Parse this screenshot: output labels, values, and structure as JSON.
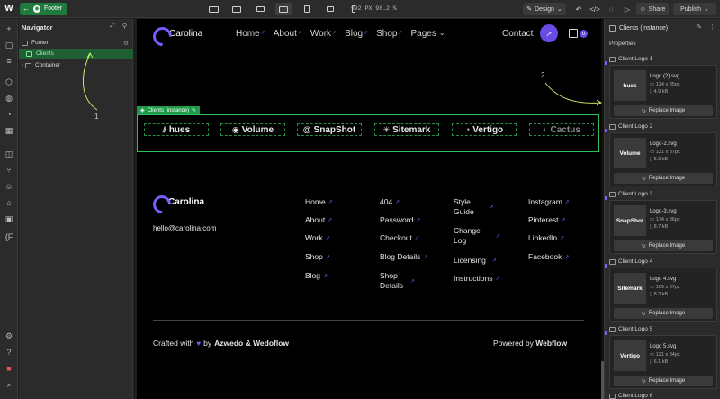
{
  "topbar": {
    "logo": "W",
    "page_name": "Footer",
    "dimensions": "992 PX 98.2 %",
    "mode_label": "Design",
    "share_label": "Share",
    "publish_label": "Publish"
  },
  "navigator": {
    "title": "Navigator",
    "items": [
      {
        "label": "Footer"
      },
      {
        "label": "Clients"
      },
      {
        "label": "Container"
      }
    ]
  },
  "site": {
    "brand": "Carolina",
    "nav": [
      "Home",
      "About",
      "Work",
      "Blog",
      "Shop",
      "Pages"
    ],
    "contact": "Contact",
    "cart_count": "0",
    "clients_label": "Clients (instance)",
    "clients": [
      "hues",
      "Volume",
      "SnapShot",
      "Sitemark",
      "Vertigo",
      "Cactus"
    ],
    "email": "hello@carolina.com",
    "footer_cols": [
      [
        "Home",
        "About",
        "Work",
        "Shop",
        "Blog"
      ],
      [
        "404",
        "Password",
        "Checkout",
        "Blog Details",
        "Shop|Details"
      ],
      [
        "Style|Guide",
        "Change|Log",
        "Licensing",
        "Instructions"
      ],
      [
        "Instagram",
        "Pinterest",
        "LinkedIn",
        "Facebook"
      ]
    ],
    "crafted_prefix": "Crafted with",
    "crafted_by": "by",
    "crafted_authors": "Azwedo & Wedoflow",
    "powered_prefix": "Powered by",
    "powered_brand": "Webflow"
  },
  "right_panel": {
    "title": "Clients (instance)",
    "properties_label": "Properties",
    "replace_label": "Replace Image",
    "logos": [
      {
        "label": "Client Logo 1",
        "file": "Logo (2).svg",
        "dims": "124 x 35px",
        "size": "4.9 kB",
        "thumb": "hues"
      },
      {
        "label": "Client Logo 2",
        "file": "Logo-2.svg",
        "dims": "131 x 37px",
        "size": "5.3 kB",
        "thumb": "Volume"
      },
      {
        "label": "Client Logo 3",
        "file": "Logo-3.svg",
        "dims": "174 x 36px",
        "size": "8.7 kB",
        "thumb": "SnapShot"
      },
      {
        "label": "Client Logo 4",
        "file": "Logo 4.svg",
        "dims": "169 x 37px",
        "size": "8.3 kB",
        "thumb": "Sitemark"
      },
      {
        "label": "Client Logo 5",
        "file": "Logo 5.svg",
        "dims": "121 x 34px",
        "size": "6.1 kB",
        "thumb": "Vertigo"
      },
      {
        "label": "Client Logo 6"
      }
    ]
  },
  "annotations": {
    "one": "1",
    "two": "2"
  },
  "colors": {
    "accent": "#7b5cff",
    "selection_green": "#1f9a4a",
    "canvas_bg": "#000000",
    "panel_bg": "#2b2b2b"
  }
}
